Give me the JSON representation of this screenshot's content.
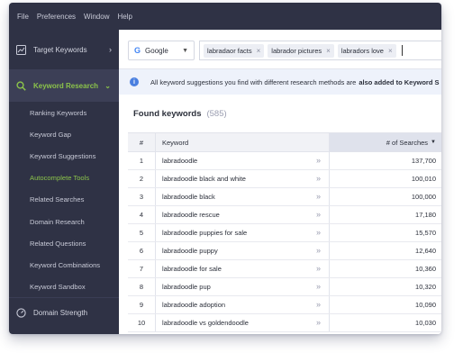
{
  "menu": [
    "File",
    "Preferences",
    "Window",
    "Help"
  ],
  "sidebar": {
    "top_item": "Target Keywords",
    "active_section": "Keyword Research",
    "sub_items": [
      "Ranking Keywords",
      "Keyword Gap",
      "Keyword Suggestions",
      "Autocomplete Tools",
      "Related Searches",
      "Domain Research",
      "Related Questions",
      "Keyword Combinations",
      "Keyword Sandbox"
    ],
    "current_sub_item": "Autocomplete Tools",
    "bottom_item": "Domain Strength"
  },
  "search": {
    "engine": "Google",
    "tags": [
      "labradaor facts",
      "labrador pictures",
      "labradors love"
    ]
  },
  "banner": {
    "text": "All keyword suggestions you find with different research methods are",
    "bold": "also added to Keyword S"
  },
  "found": {
    "title": "Found keywords",
    "count": "(585)"
  },
  "table": {
    "headers": {
      "num": "#",
      "keyword": "Keyword",
      "searches": "# of Searches"
    },
    "rows": [
      {
        "num": "1",
        "keyword": "labradoodle",
        "searches": "137,700"
      },
      {
        "num": "2",
        "keyword": "labradoodle black and white",
        "searches": "100,010"
      },
      {
        "num": "3",
        "keyword": "labradoodle black",
        "searches": "100,000"
      },
      {
        "num": "4",
        "keyword": "labradoodle rescue",
        "searches": "17,180"
      },
      {
        "num": "5",
        "keyword": "labradoodle puppies for sale",
        "searches": "15,570"
      },
      {
        "num": "6",
        "keyword": "labradoodle puppy",
        "searches": "12,640"
      },
      {
        "num": "7",
        "keyword": "labradoodle for sale",
        "searches": "10,360"
      },
      {
        "num": "8",
        "keyword": "labradoodle pup",
        "searches": "10,320"
      },
      {
        "num": "9",
        "keyword": "labradoodle adoption",
        "searches": "10,090"
      },
      {
        "num": "10",
        "keyword": "labradoodle vs goldendoodle",
        "searches": "10,030"
      }
    ]
  },
  "colors": {
    "sidebar_bg": "#2f3245",
    "accent_green": "#8bc34a",
    "info_blue": "#4a7fe0"
  }
}
